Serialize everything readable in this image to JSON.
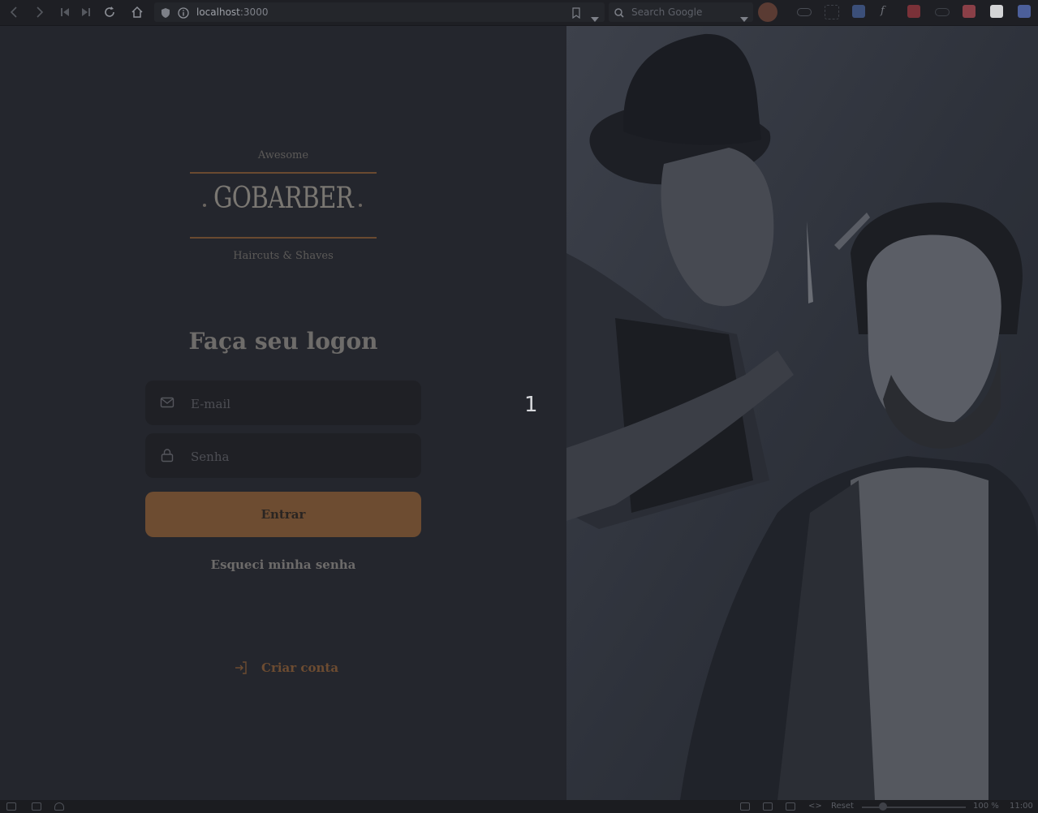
{
  "browser": {
    "url_host": "localhost",
    "url_port": ":3000",
    "search_placeholder": "Search Google"
  },
  "logo": {
    "top_text": "Awesome",
    "main_text": "GOBARBER",
    "bottom_text": "Haircuts & Shaves"
  },
  "form": {
    "title": "Faça seu logon",
    "email_placeholder": "E-mail",
    "password_placeholder": "Senha",
    "submit_label": "Entrar",
    "forgot_label": "Esqueci minha senha"
  },
  "create_account_label": "Criar conta",
  "overlay_marker": "1",
  "status_bar": {
    "reset_label": "Reset",
    "zoom_level": "100 %",
    "time": "11:00"
  },
  "colors": {
    "accent": "#ff9000",
    "background": "#312e38",
    "input_bg": "#232129"
  },
  "icons": [
    "back-icon",
    "forward-icon",
    "first-icon",
    "last-icon",
    "reload-icon",
    "home-icon",
    "shield-icon",
    "info-icon",
    "bookmark-icon",
    "mail-icon",
    "lock-icon",
    "log-in-icon"
  ]
}
